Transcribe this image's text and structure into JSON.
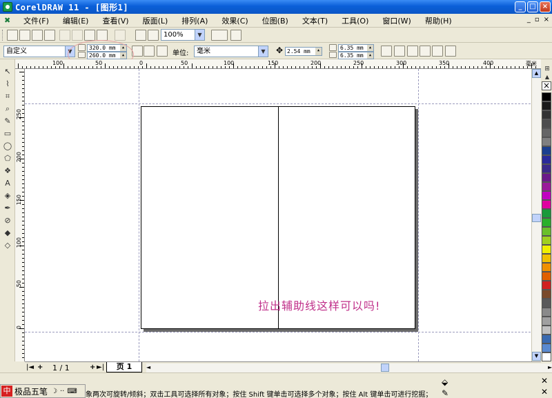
{
  "window": {
    "title": "CorelDRAW 11 - [图形1]",
    "min_label": "_",
    "max_label": "□",
    "close_label": "×",
    "doc_min_label": "_",
    "doc_restore_label": "▫",
    "doc_close_label": "×"
  },
  "menu": [
    "文件(F)",
    "编辑(E)",
    "查看(V)",
    "版面(L)",
    "排列(A)",
    "效果(C)",
    "位图(B)",
    "文本(T)",
    "工具(O)",
    "窗口(W)",
    "帮助(H)"
  ],
  "toolbar": {
    "zoom": "100%"
  },
  "property_bar": {
    "paper_preset": "自定义",
    "width": "320.0 mm",
    "height": "260.0 mm",
    "unit_label": "单位:",
    "unit_value": "毫米",
    "nudge": "2.54 mm",
    "dup_x": "6.35 mm",
    "dup_y": "6.35 mm"
  },
  "ruler": {
    "h_labels": [
      "100",
      "50",
      "0",
      "50",
      "100",
      "150",
      "200",
      "250",
      "300",
      "350",
      "400"
    ],
    "h_unit": "毫米",
    "v_labels": [
      "250",
      "200",
      "150",
      "100",
      "50",
      "0"
    ]
  },
  "canvas": {
    "annotation": "拉出辅助线这样可以吗!"
  },
  "page_nav": {
    "count": "1 / 1",
    "tab_label": "页 1",
    "first": "|◄",
    "prev": "◄",
    "add_before": "+",
    "add_after": "+",
    "next": "►",
    "last": "►|"
  },
  "status": {
    "text": "象两次可旋转/倾斜；双击工具可选择所有对象；按住 Shift 键单击可选择多个对象；按住 Alt 键单击可进行挖掘；按...",
    "ime_char": "中",
    "ime_name": "极品五笔",
    "ime_moon": "☽",
    "ime_dots": "··"
  },
  "palette_colors": [
    "#000000",
    "#1a1a1a",
    "#333333",
    "#4d4d4d",
    "#666666",
    "#808080",
    "#1b3f8f",
    "#2a2a9a",
    "#3b2a8a",
    "#6b1a8a",
    "#9a1a9a",
    "#c000c0",
    "#e000a0",
    "#1a9a3a",
    "#2ab02a",
    "#6ac02a",
    "#a0d020",
    "#f0f000",
    "#f0c000",
    "#f09000",
    "#e06000",
    "#d02020",
    "#7a4a2a",
    "#5a5a5a",
    "#8a8a8a",
    "#a0a0a0",
    "#c0c0c0",
    "#3a6ab0",
    "#5a8ad0",
    "#ffffff"
  ],
  "colors": {
    "titlebar": "#0a5fd8",
    "annotation": "#c0308a",
    "guide": "#9a9abd"
  }
}
